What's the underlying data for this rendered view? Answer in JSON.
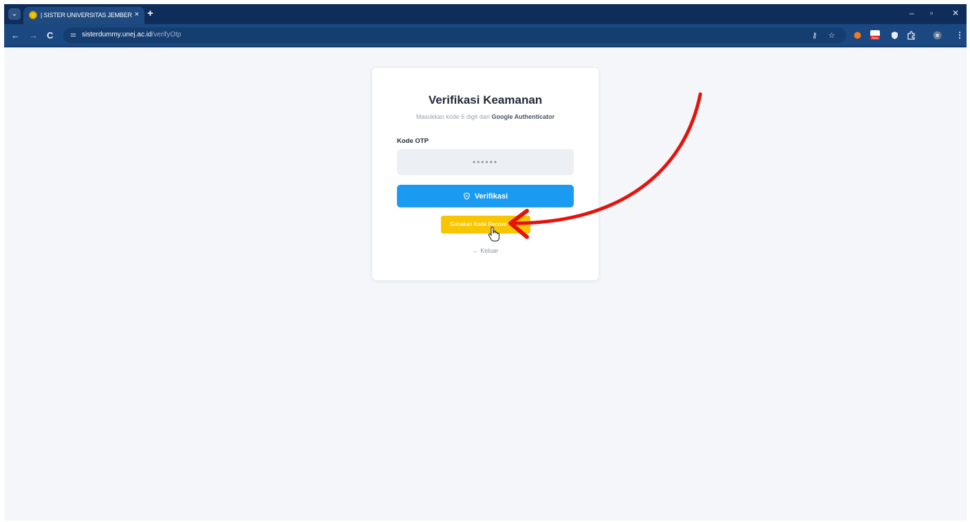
{
  "browser": {
    "tab_title": "| SISTER UNIVERSITAS JEMBER",
    "tab_close": "×",
    "new_tab": "+",
    "url_host": "sisterdummy.unej.ac.id",
    "url_path": "/verifyOtp",
    "window_controls": [
      "–",
      "▫",
      "✕"
    ],
    "nav": {
      "back": "←",
      "forward": "→",
      "reload": "C"
    },
    "ext_badge": "New"
  },
  "card": {
    "title": "Verifikasi Keamanan",
    "subtitle_prefix": "Masukkan kode 6 digit dari",
    "subtitle_bold": "Google Authenticator",
    "otp_label": "Kode OTP",
    "otp_placeholder": "••••••",
    "verify_label": "Verifikasi",
    "recovery_label": "Gunakan Kode Recove",
    "logout_label": "← Keluar"
  },
  "icons": {
    "shield": "shield-icon",
    "cursor": "hand-cursor-icon",
    "annotation": "red-arrow-annotation"
  },
  "colors": {
    "primary": "#1a9af1",
    "recovery": "#f7c600",
    "annotation": "#e4140c",
    "chrome": "#1b4880"
  }
}
